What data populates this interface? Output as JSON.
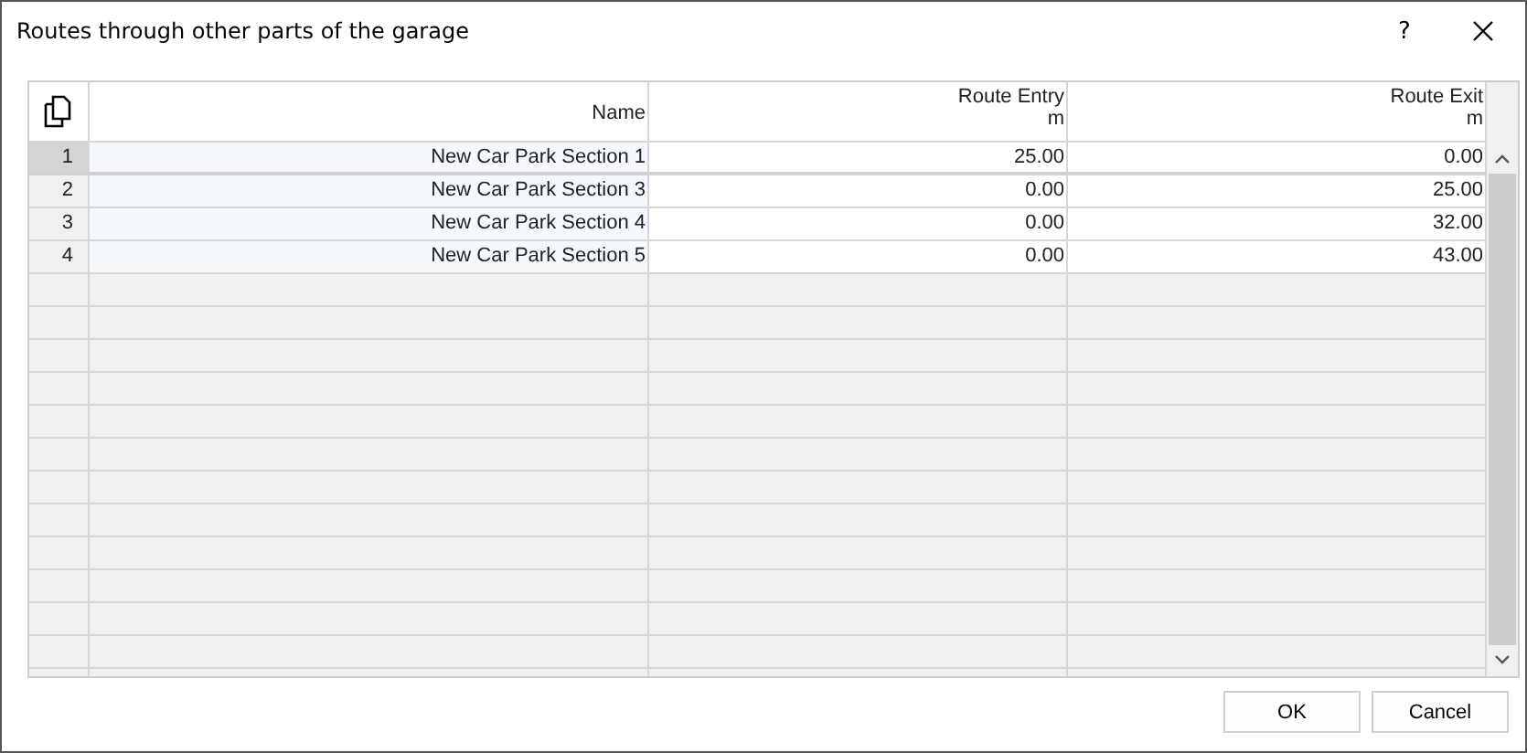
{
  "window": {
    "title": "Routes through other parts of the garage",
    "help": "?"
  },
  "table": {
    "columns": [
      {
        "title": "Name"
      },
      {
        "title": "Route Entry",
        "unit": "m"
      },
      {
        "title": "Route Exit",
        "unit": "m"
      }
    ],
    "rows": [
      {
        "number": "1",
        "name": "New Car Park Section 1",
        "entry": "25.00",
        "exit": "0.00",
        "selected": true
      },
      {
        "number": "2",
        "name": "New Car Park Section 3",
        "entry": "0.00",
        "exit": "25.00",
        "selected": false
      },
      {
        "number": "3",
        "name": "New Car Park Section 4",
        "entry": "0.00",
        "exit": "32.00",
        "selected": false
      },
      {
        "number": "4",
        "name": "New Car Park Section 5",
        "entry": "0.00",
        "exit": "43.00",
        "selected": false
      }
    ]
  },
  "buttons": [
    "OK",
    "Cancel"
  ]
}
